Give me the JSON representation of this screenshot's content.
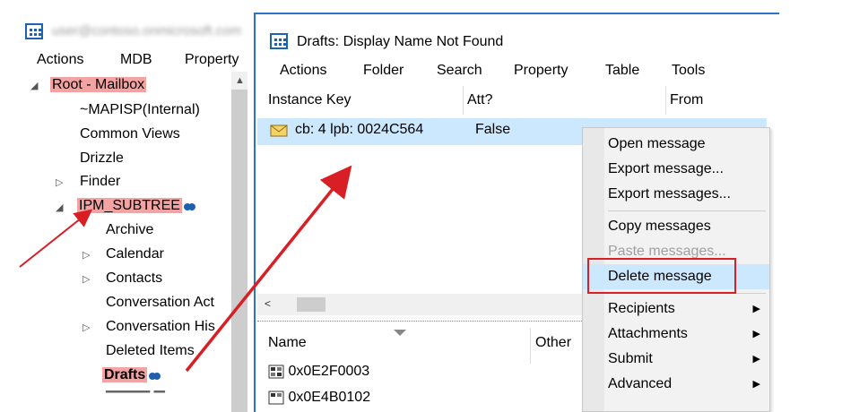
{
  "main_window": {
    "title": "user@contoso.onmicrosoft.com",
    "menu": [
      "Actions",
      "MDB",
      "Property"
    ],
    "tree": {
      "root": "Root - Mailbox",
      "items": [
        {
          "label": "~MAPISP(Internal)"
        },
        {
          "label": "Common Views"
        },
        {
          "label": "Drizzle"
        },
        {
          "label": "Finder"
        },
        {
          "label": "IPM_SUBTREE"
        },
        {
          "label": "Archive"
        },
        {
          "label": "Calendar"
        },
        {
          "label": "Contacts"
        },
        {
          "label": "Conversation Act"
        },
        {
          "label": "Conversation His"
        },
        {
          "label": "Deleted Items"
        },
        {
          "label": "Drafts"
        }
      ]
    }
  },
  "drafts_window": {
    "title": "Drafts: Display Name Not Found",
    "menu": [
      "Actions",
      "Folder",
      "Search",
      "Property",
      "Table",
      "Tools"
    ],
    "columns": [
      "Instance Key",
      "Att?",
      "From"
    ],
    "rows": [
      {
        "instance_key": "cb: 4 lpb: 0024C564",
        "att": "False"
      }
    ],
    "props_columns": [
      "Name",
      "Other"
    ],
    "props_rows": [
      "0x0E2F0003",
      "0x0E4B0102"
    ]
  },
  "context_menu": {
    "items": [
      {
        "label": "Open message"
      },
      {
        "label": "Export message..."
      },
      {
        "label": "Export messages..."
      },
      {
        "label": "Copy messages"
      },
      {
        "label": "Paste messages..."
      },
      {
        "label": "Delete message"
      },
      {
        "label": "Recipients"
      },
      {
        "label": "Attachments"
      },
      {
        "label": "Submit"
      },
      {
        "label": "Advanced"
      }
    ]
  },
  "colors": {
    "highlight": "#f4a3a3",
    "annotation_red": "#d81f26",
    "selection_blue": "#cce8ff",
    "window_border": "#2b74c8"
  },
  "icons": [
    "app-icon",
    "envelope-icon",
    "sync-icon",
    "scroll-up-icon",
    "scroll-left-icon",
    "property-icon",
    "submenu-arrow-icon"
  ]
}
